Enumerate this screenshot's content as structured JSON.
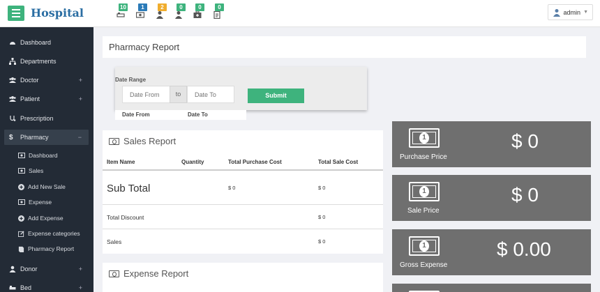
{
  "app": {
    "brand": "Hospital",
    "user": "admin"
  },
  "notifications": [
    {
      "name": "bed-notif",
      "count": "10",
      "color": "#3eb37d"
    },
    {
      "name": "payment-notif",
      "count": "1",
      "color": "#2b7bb8"
    },
    {
      "name": "patient-notif",
      "count": "2",
      "color": "#f0ad2e"
    },
    {
      "name": "donor-notif",
      "count": "0",
      "color": "#3eb37d"
    },
    {
      "name": "medicine-notif",
      "count": "0",
      "color": "#3eb37d"
    },
    {
      "name": "report-notif",
      "count": "0",
      "color": "#3eb37d"
    }
  ],
  "sidebar": {
    "items": [
      {
        "label": "Dashboard"
      },
      {
        "label": "Departments"
      },
      {
        "label": "Doctor",
        "expand": "+"
      },
      {
        "label": "Patient",
        "expand": "+"
      },
      {
        "label": "Prescription"
      },
      {
        "label": "Pharmacy",
        "expand": "−"
      },
      {
        "label": "Donor",
        "expand": "+"
      },
      {
        "label": "Bed",
        "expand": "+"
      }
    ],
    "pharmacy_sub": [
      {
        "label": "Dashboard"
      },
      {
        "label": "Sales"
      },
      {
        "label": "Add New Sale"
      },
      {
        "label": "Expense"
      },
      {
        "label": "Add Expense"
      },
      {
        "label": "Expense categories"
      },
      {
        "label": "Pharmacy Report"
      }
    ]
  },
  "page": {
    "title": "Pharmacy Report"
  },
  "filter": {
    "label": "Date Range",
    "from_placeholder": "Date From",
    "to_text": "to",
    "to_placeholder": "Date To",
    "submit": "Submit",
    "col_from": "Date From",
    "col_to": "Date To"
  },
  "sales_report": {
    "title": "Sales Report",
    "headers": [
      "Item Name",
      "Quantity",
      "Total Purchase Cost",
      "Total Sale Cost"
    ],
    "subtotal_label": "Sub Total",
    "subtotal_purchase": "$ 0",
    "subtotal_sale": "$ 0",
    "discount_label": "Total Discount",
    "discount_value": "$ 0",
    "sales_label": "Sales",
    "sales_value": "$ 0"
  },
  "expense_report": {
    "title": "Expense Report"
  },
  "tiles": [
    {
      "label": "Purchase Price",
      "value": "$ 0"
    },
    {
      "label": "Sale Price",
      "value": "$ 0"
    },
    {
      "label": "Gross Expense",
      "value": "$ 0.00"
    }
  ]
}
